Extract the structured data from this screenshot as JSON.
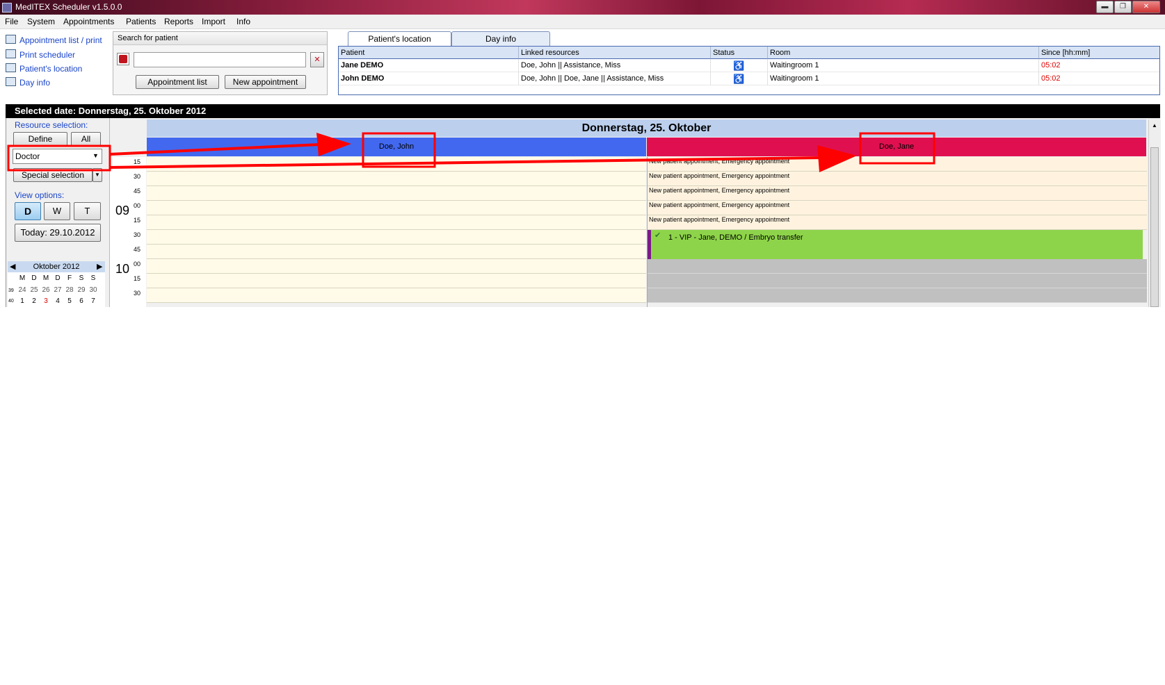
{
  "window": {
    "title": "MedITEX  Scheduler v1.5.0.0",
    "controls": [
      "▬",
      "❐",
      "✕"
    ]
  },
  "menu": [
    "File",
    "System",
    "Appointments",
    "Patients",
    "Reports",
    "Import",
    "Info"
  ],
  "left_links": [
    {
      "label": "Appointment list / print",
      "icon": "list-icon"
    },
    {
      "label": "Print scheduler",
      "icon": "printer-icon"
    },
    {
      "label": "Patient's location",
      "icon": "location-icon"
    },
    {
      "label": "Day info",
      "icon": "info-icon"
    }
  ],
  "search": {
    "title": "Search for patient",
    "value": "",
    "appointment_list": "Appointment list",
    "new_appointment": "New appointment"
  },
  "location": {
    "tabs": [
      "Patient's location",
      "Day info"
    ],
    "columns": [
      "Patient",
      "Linked resources",
      "Status",
      "Room",
      "Since [hh:mm]"
    ],
    "rows": [
      {
        "patient": "Jane DEMO",
        "resources": "Doe, John || Assistance, Miss",
        "room": "Waitingroom 1",
        "since": "05:02"
      },
      {
        "patient": "John DEMO",
        "resources": "Doe, John || Doe, Jane || Assistance, Miss",
        "room": "Waitingroom 1",
        "since": "05:02"
      }
    ],
    "since_color": "#e00000"
  },
  "selected_date": "Selected date: Donnerstag, 25. Oktober 2012",
  "resource": {
    "label": "Resource selection:",
    "define": "Define",
    "all": "All",
    "dropdown_value": "Doctor",
    "special": "Special selection"
  },
  "view": {
    "label": "View options:",
    "buttons": [
      "D",
      "W",
      "T"
    ],
    "active": "D",
    "today": "Today: 29.10.2012"
  },
  "mini_calendar": {
    "month": "Oktober 2012",
    "weekdays": [
      "M",
      "D",
      "M",
      "D",
      "F",
      "S",
      "S"
    ],
    "weeks": [
      {
        "kw": "39",
        "days": [
          "24",
          "25",
          "26",
          "27",
          "28",
          "29",
          "30"
        ]
      },
      {
        "kw": "40",
        "days": [
          "1",
          "2",
          "3",
          "4",
          "5",
          "6",
          "7"
        ]
      }
    ],
    "red_day": "3"
  },
  "day_header": "Donnerstag, 25. Oktober",
  "doctors": [
    {
      "name": "Doe, John",
      "color": "#4268f0"
    },
    {
      "name": "Doe, Jane",
      "color": "#e01050"
    }
  ],
  "time_slots": [
    {
      "hour": "",
      "min": "15"
    },
    {
      "hour": "",
      "min": "30"
    },
    {
      "hour": "",
      "min": "45"
    },
    {
      "hour": "09",
      "min": "00"
    },
    {
      "hour": "",
      "min": "15"
    },
    {
      "hour": "",
      "min": "30"
    },
    {
      "hour": "",
      "min": "45"
    },
    {
      "hour": "10",
      "min": "00"
    },
    {
      "hour": "",
      "min": "15"
    },
    {
      "hour": "",
      "min": "30"
    }
  ],
  "jane_slots": [
    "New patient appointment, Emergency appointment",
    "New patient appointment, Emergency appointment",
    "New patient appointment, Emergency appointment",
    "New patient appointment, Emergency appointment",
    "New patient appointment, Emergency appointment"
  ],
  "appointment": {
    "label": "1 - VIP - Jane, DEMO / Embryo transfer",
    "color": "#8ed44a",
    "stripe": "#7a1a8a"
  }
}
